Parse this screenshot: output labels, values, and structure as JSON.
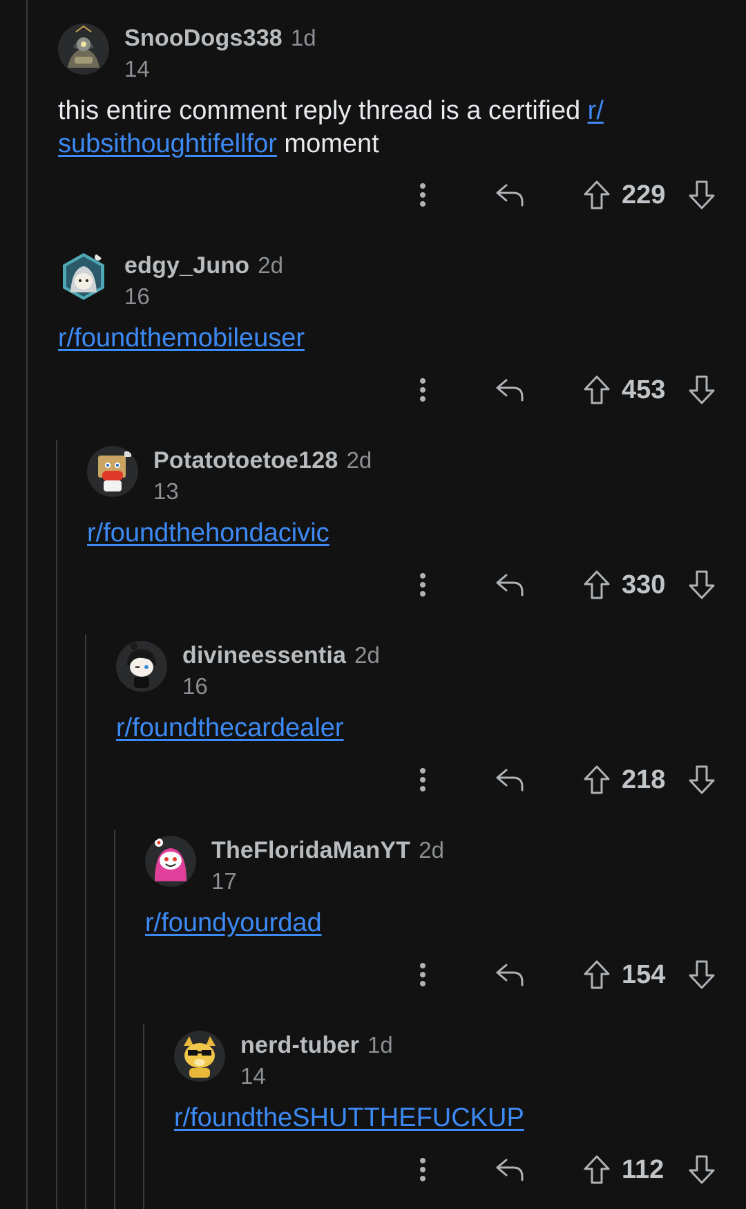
{
  "comments": [
    {
      "username": "SnooDogs338",
      "age": "1d",
      "karma": "14",
      "text_before": "this entire comment reply thread is a certified ",
      "link": "r/​subsithoughtifellfor",
      "text_after": " moment",
      "votes": "229",
      "avatar": "robot-avatar-icon"
    },
    {
      "username": "edgy_Juno",
      "age": "2d",
      "karma": "16",
      "text_before": "",
      "link": "r/foundthemobileuser",
      "text_after": "",
      "votes": "453",
      "avatar": "hooded-snoo-avatar-icon"
    },
    {
      "username": "Potatotoetoe128",
      "age": "2d",
      "karma": "13",
      "text_before": "",
      "link": "r/foundthehondacivic",
      "text_after": "",
      "votes": "330",
      "avatar": "box-head-snoo-avatar-icon"
    },
    {
      "username": "divineessentia",
      "age": "2d",
      "karma": "16",
      "text_before": "",
      "link": "r/foundthecardealer",
      "text_after": "",
      "votes": "218",
      "avatar": "black-hair-snoo-avatar-icon"
    },
    {
      "username": "TheFloridaManYT",
      "age": "2d",
      "karma": "17",
      "text_before": "",
      "link": "r/foundyourdad",
      "text_after": "",
      "votes": "154",
      "avatar": "pink-hoodie-snoo-avatar-icon"
    },
    {
      "username": "nerd-tuber",
      "age": "1d",
      "karma": "14",
      "text_before": "",
      "link": "r/foundtheSHUTTHEFUCKUP",
      "text_after": "",
      "votes": "112",
      "avatar": "doge-sunglasses-avatar-icon"
    }
  ],
  "colors": {
    "background": "#121212",
    "link": "#3d8af7",
    "thread_line": "#3a3a3c",
    "text": "#e8eaed",
    "muted": "#8c9094"
  }
}
